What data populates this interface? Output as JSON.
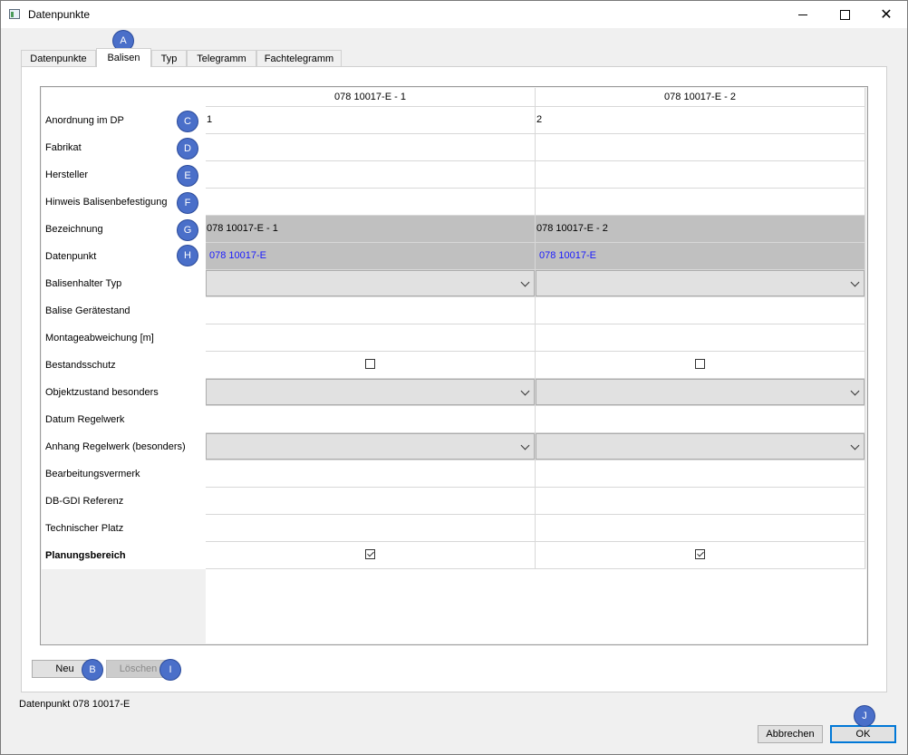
{
  "window": {
    "title": "Datenpunkte"
  },
  "tabs": [
    {
      "label": "Datenpunkte"
    },
    {
      "label": "Balisen"
    },
    {
      "label": "Typ"
    },
    {
      "label": "Telegramm"
    },
    {
      "label": "Fachtelegramm"
    }
  ],
  "active_tab": "Balisen",
  "grid": {
    "columns": [
      "078 10017-E - 1",
      "078 10017-E - 2"
    ],
    "rows": [
      {
        "label": "Anordnung im DP",
        "values": [
          "1",
          "2"
        ]
      },
      {
        "label": "Fabrikat",
        "values": [
          "",
          ""
        ]
      },
      {
        "label": "Hersteller",
        "values": [
          "",
          ""
        ]
      },
      {
        "label": "Hinweis Balisenbefestigung",
        "values": [
          "",
          ""
        ]
      },
      {
        "label": "Bezeichnung",
        "values": [
          "078 10017-E - 1",
          "078 10017-E - 2"
        ]
      },
      {
        "label": "Datenpunkt",
        "values": [
          "078 10017-E",
          "078 10017-E"
        ]
      },
      {
        "label": "Balisenhalter Typ",
        "values": [
          "",
          ""
        ]
      },
      {
        "label": "Balise Gerätestand",
        "values": [
          "",
          ""
        ]
      },
      {
        "label": "Montageabweichung [m]",
        "values": [
          "",
          ""
        ]
      },
      {
        "label": "Bestandsschutz",
        "values": [
          "unchecked",
          "unchecked"
        ]
      },
      {
        "label": "Objektzustand besonders",
        "values": [
          "",
          ""
        ]
      },
      {
        "label": "Datum Regelwerk",
        "values": [
          "",
          ""
        ]
      },
      {
        "label": "Anhang Regelwerk (besonders)",
        "values": [
          "",
          ""
        ]
      },
      {
        "label": "Bearbeitungsvermerk",
        "values": [
          "",
          ""
        ]
      },
      {
        "label": "DB-GDI Referenz",
        "values": [
          "",
          ""
        ]
      },
      {
        "label": "Technischer Platz",
        "values": [
          "",
          ""
        ]
      },
      {
        "label": "Planungsbereich",
        "values": [
          "checked",
          "checked"
        ]
      }
    ]
  },
  "buttons": {
    "neu": "Neu",
    "loeschen": "Löschen",
    "abbrechen": "Abbrechen",
    "ok": "OK"
  },
  "status_text": "Datenpunkt 078 10017-E",
  "badges": [
    "A",
    "B",
    "C",
    "D",
    "E",
    "F",
    "G",
    "H",
    "I",
    "J"
  ],
  "colors": {
    "badge": "#4a6fc9",
    "link": "#1a1aff",
    "readonly_cell": "#c0c0c0",
    "default_button_border": "#0078d7"
  }
}
